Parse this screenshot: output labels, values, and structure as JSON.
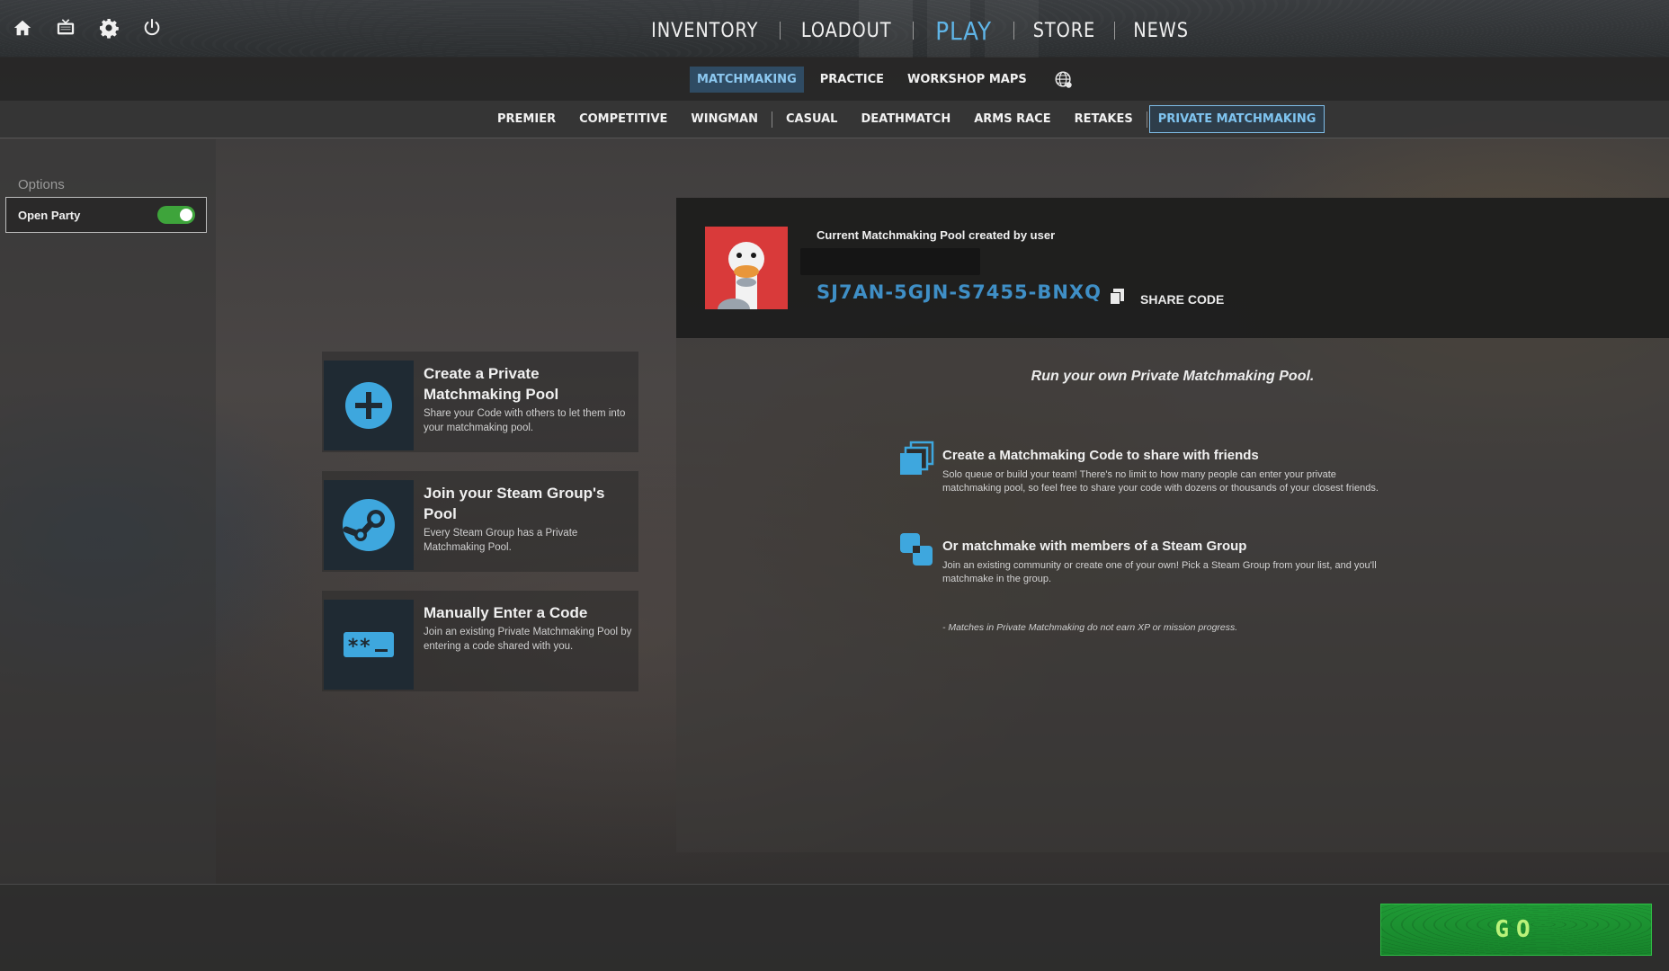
{
  "top_nav": {
    "items": [
      {
        "label": "INVENTORY"
      },
      {
        "label": "LOADOUT"
      },
      {
        "label": "PLAY"
      },
      {
        "label": "STORE"
      },
      {
        "label": "NEWS"
      }
    ],
    "active": "PLAY",
    "left_icons": [
      "home-icon",
      "tv-icon",
      "gear-icon",
      "power-icon"
    ]
  },
  "sub_nav": {
    "tabs": [
      {
        "label": "MATCHMAKING"
      },
      {
        "label": "PRACTICE"
      },
      {
        "label": "WORKSHOP MAPS"
      }
    ],
    "active": "MATCHMAKING",
    "extra_icon": "globe-icon"
  },
  "mode_nav": {
    "modes": [
      {
        "label": "PREMIER"
      },
      {
        "label": "COMPETITIVE"
      },
      {
        "label": "WINGMAN"
      },
      {
        "label": "CASUAL"
      },
      {
        "label": "DEATHMATCH"
      },
      {
        "label": "ARMS RACE"
      },
      {
        "label": "RETAKES"
      },
      {
        "label": "PRIVATE MATCHMAKING"
      }
    ],
    "active": "PRIVATE MATCHMAKING"
  },
  "options": {
    "title": "Options",
    "open_party": {
      "label": "Open Party",
      "enabled": true
    }
  },
  "cards": [
    {
      "icon": "plus-icon",
      "title": "Create a Private Matchmaking Pool",
      "desc": "Share your Code with others to let them into your matchmaking pool."
    },
    {
      "icon": "steam-icon",
      "title": "Join your Steam Group's Pool",
      "desc": "Every Steam Group has a Private Matchmaking Pool."
    },
    {
      "icon": "code-entry-icon",
      "title": "Manually Enter a Code",
      "desc": "Join an existing Private Matchmaking Pool by entering a code shared with you."
    }
  ],
  "pool": {
    "created_by": "Current Matchmaking Pool created by user",
    "code": "SJ7AN-5GJN-S7455-BNXQ",
    "share_label": "SHARE CODE"
  },
  "info": {
    "tagline": "Run your own Private Matchmaking Pool.",
    "features": [
      {
        "icon": "copy-stack-icon",
        "title": "Create a Matchmaking Code to share with friends",
        "desc": "Solo queue or build your team! There's no limit to how many people can enter your private matchmaking pool, so feel free to share your code with dozens or thousands of your closest friends."
      },
      {
        "icon": "group-squares-icon",
        "title": "Or matchmake with members of a Steam Group",
        "desc": "Join an existing community or create one of your own! Pick a Steam Group from your list, and you'll matchmake in the group."
      }
    ],
    "footnote": "- Matches in Private Matchmaking do not earn XP or mission progress."
  },
  "go_button": {
    "label": "GO"
  },
  "colors": {
    "accent_blue": "#5fb4e6",
    "code_blue": "#3f8fc6",
    "go_green": "#1f9a35",
    "toggle_green": "#3ea43b",
    "avatar_red": "#d93a3a"
  }
}
